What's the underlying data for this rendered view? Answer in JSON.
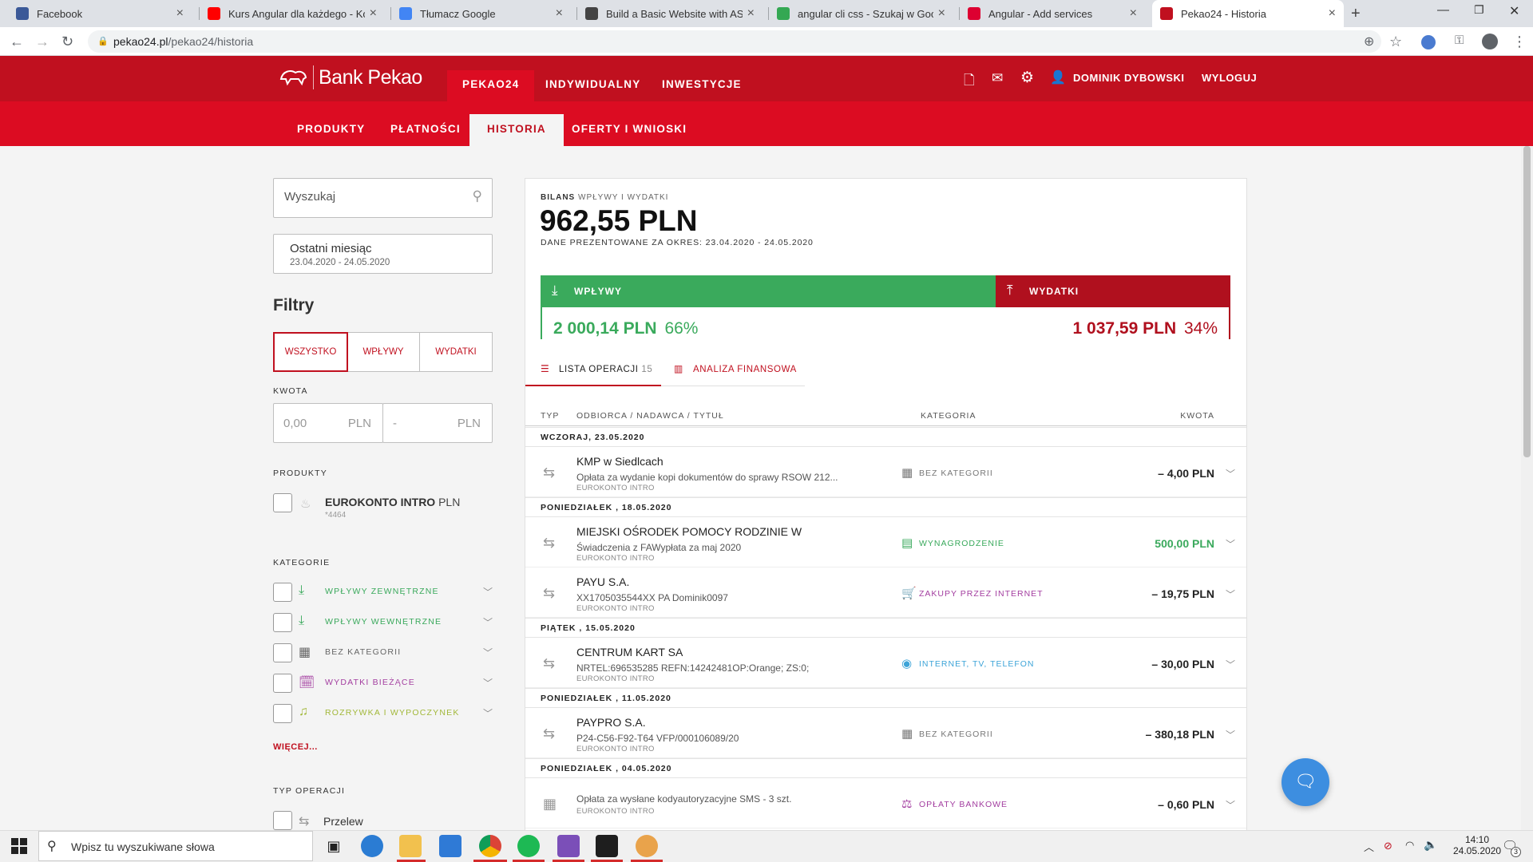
{
  "browser": {
    "tabs": [
      {
        "title": "Facebook",
        "color": "#3b5998"
      },
      {
        "title": "Kurs Angular dla każdego - Komp",
        "color": "#ff0000"
      },
      {
        "title": "Tłumacz Google",
        "color": "#4285f4"
      },
      {
        "title": "Build a Basic Website with ASP.N",
        "color": "#444444"
      },
      {
        "title": "angular cli css - Szukaj w Google",
        "color": "#34a853"
      },
      {
        "title": "Angular - Add services",
        "color": "#dd0031"
      },
      {
        "title": "Pekao24 - Historia",
        "color": "#c0101f"
      }
    ],
    "url_domain": "pekao24.pl",
    "url_path": "/pekao24/historia"
  },
  "bank": {
    "logo": "Bank Pekao",
    "top_tabs": [
      "PEKAO24",
      "INDYWIDUALNY",
      "INWESTYCJE"
    ],
    "sub_tabs": [
      "PRODUKTY",
      "PŁATNOŚCI",
      "HISTORIA",
      "OFERTY I WNIOSKI"
    ],
    "user": "DOMINIK DYBOWSKI",
    "logout": "WYLOGUJ"
  },
  "left": {
    "search_placeholder": "Wyszukaj",
    "period_title": "Ostatni miesiąc",
    "period_range": "23.04.2020 - 24.05.2020",
    "filters_title": "Filtry",
    "filter_buttons": [
      "WSZYSTKO",
      "WPŁYWY",
      "WYDATKI"
    ],
    "amount_label": "KWOTA",
    "amount_from": "0,00",
    "amount_sep": "-",
    "currency": "PLN",
    "products_label": "PRODUKTY",
    "product_name": "EUROKONTO INTRO",
    "product_currency": "PLN",
    "product_number": "*4464",
    "categories_label": "KATEGORIE",
    "categories": [
      {
        "label": "WPŁYWY ZEWNĘTRZNE",
        "color": "#3aa95c"
      },
      {
        "label": "WPŁYWY WEWNĘTRZNE",
        "color": "#3aa95c"
      },
      {
        "label": "BEZ KATEGORII",
        "color": "#666666"
      },
      {
        "label": "WYDATKI BIEŻĄCE",
        "color": "#a33ea0"
      },
      {
        "label": "ROZRYWKA I WYPOCZYNEK",
        "color": "#a2b83a"
      }
    ],
    "more": "WIĘCEJ...",
    "optype_label": "TYP OPERACJI",
    "optype_first": "Przelew"
  },
  "summary": {
    "balance_label": "BILANS",
    "balance_sub": "WPŁYWY I WYDATKI",
    "balance": "962,55 PLN",
    "period": "DANE PREZENTOWANE ZA OKRES: 23.04.2020 - 24.05.2020",
    "income_label": "WPŁYWY",
    "income": "2 000,14 PLN",
    "income_pct": "66%",
    "income_share": 0.66,
    "expense_label": "WYDATKI",
    "expense": "1 037,59 PLN",
    "expense_pct": "34%",
    "green": "#3aaa5c",
    "red": "#b0101e"
  },
  "tabs": {
    "list": "LISTA OPERACJI",
    "count": "15",
    "analysis": "ANALIZA FINANSOWA"
  },
  "columns": [
    "TYP",
    "ODBIORCA / NADAWCA / TYTUŁ",
    "KATEGORIA",
    "KWOTA"
  ],
  "groups": [
    {
      "date": "WCZORAJ, 23.05.2020",
      "ops": [
        {
          "name": "KMP w Siedlcach",
          "desc": "Opłata za wydanie kopi dokumentów do sprawy RSOW 212...",
          "acct": "EUROKONTO INTRO",
          "cat": "BEZ KATEGORII",
          "cat_color": "#777777",
          "amount": "– 4,00 PLN",
          "amt_color": "#222222"
        }
      ]
    },
    {
      "date": "PONIEDZIAŁEK , 18.05.2020",
      "ops": [
        {
          "name": "MIEJSKI OŚRODEK POMOCY RODZINIE W",
          "desc": "Świadczenia z FAWypłata za maj 2020",
          "acct": "EUROKONTO INTRO",
          "cat": "WYNAGRODZENIE",
          "cat_color": "#3aa95c",
          "amount": "500,00 PLN",
          "amt_color": "#3aa95c"
        },
        {
          "name": "PAYU S.A.",
          "desc": "XX1705035544XX PA Dominik0097",
          "acct": "EUROKONTO INTRO",
          "cat": "ZAKUPY PRZEZ INTERNET",
          "cat_color": "#a33ea0",
          "amount": "– 19,75 PLN",
          "amt_color": "#222222"
        }
      ]
    },
    {
      "date": "PIĄTEK , 15.05.2020",
      "ops": [
        {
          "name": "CENTRUM KART SA",
          "desc": "NRTEL:696535285 REFN:14242481OP:Orange; ZS:0;",
          "acct": "EUROKONTO INTRO",
          "cat": "INTERNET, TV, TELEFON",
          "cat_color": "#3da4d8",
          "amount": "– 30,00 PLN",
          "amt_color": "#222222"
        }
      ]
    },
    {
      "date": "PONIEDZIAŁEK , 11.05.2020",
      "ops": [
        {
          "name": "PAYPRO S.A.",
          "desc": "P24-C56-F92-T64 VFP/000106089/20",
          "acct": "EUROKONTO INTRO",
          "cat": "BEZ KATEGORII",
          "cat_color": "#777777",
          "amount": "– 380,18 PLN",
          "amt_color": "#222222"
        }
      ]
    },
    {
      "date": "PONIEDZIAŁEK , 04.05.2020",
      "ops": [
        {
          "name": "",
          "desc": "Opłata za wysłane kodyautoryzacyjne SMS - 3 szt.",
          "acct": "EUROKONTO INTRO",
          "cat": "OPŁATY BANKOWE",
          "cat_color": "#a33ea0",
          "amount": "– 0,60 PLN",
          "amt_color": "#222222"
        }
      ]
    }
  ],
  "taskbar": {
    "search_placeholder": "Wpisz tu wyszukiwane słowa",
    "time": "14:10",
    "date": "24.05.2020",
    "notif": "3"
  }
}
